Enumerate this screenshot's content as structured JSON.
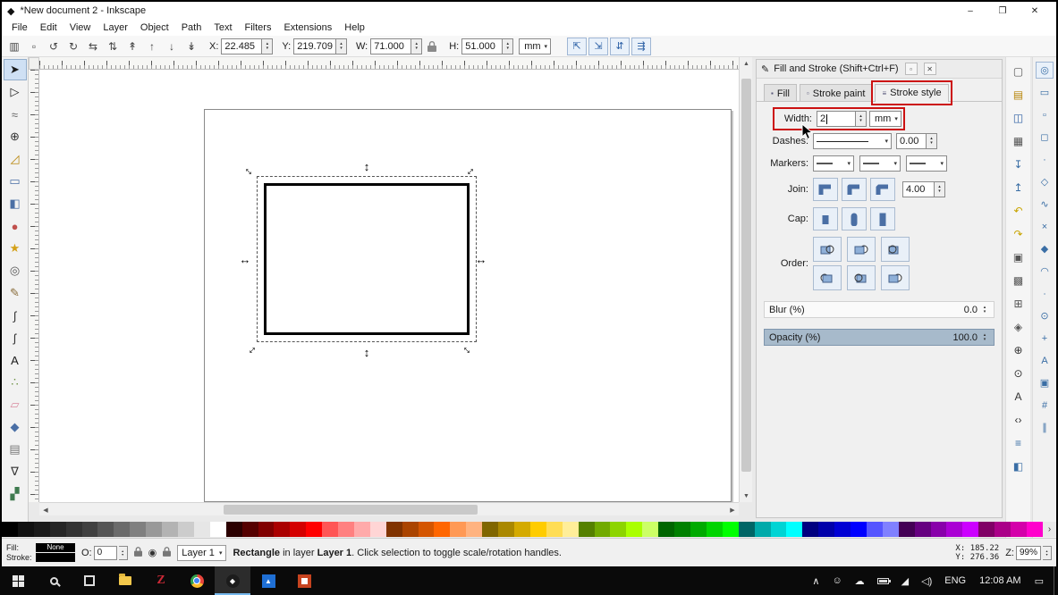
{
  "window": {
    "title": "*New document 2 - Inkscape",
    "minimize": "–",
    "maximize": "❐",
    "close": "✕"
  },
  "menubar": [
    {
      "name": "menu-file",
      "label": "File"
    },
    {
      "name": "menu-edit",
      "label": "Edit"
    },
    {
      "name": "menu-view",
      "label": "View"
    },
    {
      "name": "menu-layer",
      "label": "Layer"
    },
    {
      "name": "menu-object",
      "label": "Object"
    },
    {
      "name": "menu-path",
      "label": "Path"
    },
    {
      "name": "menu-text",
      "label": "Text"
    },
    {
      "name": "menu-filters",
      "label": "Filters"
    },
    {
      "name": "menu-extensions",
      "label": "Extensions"
    },
    {
      "name": "menu-help",
      "label": "Help"
    }
  ],
  "toolbar": {
    "icons_left": [
      {
        "name": "select-all-icon",
        "glyph": "▥"
      },
      {
        "name": "deselect-icon",
        "glyph": "▫"
      },
      {
        "name": "rotate-ccw-icon",
        "glyph": "↺"
      },
      {
        "name": "rotate-cw-icon",
        "glyph": "↻"
      },
      {
        "name": "flip-horizontal-icon",
        "glyph": "⇆"
      },
      {
        "name": "flip-vertical-icon",
        "glyph": "⇅"
      },
      {
        "name": "raise-to-top-icon",
        "glyph": "↟"
      },
      {
        "name": "raise-icon",
        "glyph": "↑"
      },
      {
        "name": "lower-icon",
        "glyph": "↓"
      },
      {
        "name": "lower-to-bottom-icon",
        "glyph": "↡"
      }
    ],
    "fields": [
      {
        "name": "x-field",
        "label": "X:",
        "value": "22.485"
      },
      {
        "name": "y-field",
        "label": "Y:",
        "value": "219.709"
      },
      {
        "name": "w-field",
        "label": "W:",
        "value": "71.000"
      }
    ],
    "h_field": {
      "label": "H:",
      "value": "51.000"
    },
    "units": "mm",
    "toggles": [
      {
        "name": "scale-stroke-toggle",
        "glyph": "⇱"
      },
      {
        "name": "scale-corners-toggle",
        "glyph": "⇲"
      },
      {
        "name": "scale-gradient-toggle",
        "glyph": "⇵"
      },
      {
        "name": "scale-pattern-toggle",
        "glyph": "⇶"
      }
    ]
  },
  "tools": [
    {
      "name": "selector-tool",
      "glyph": "➤",
      "color": "#1a1a1a"
    },
    {
      "name": "node-tool",
      "glyph": "▷",
      "color": "#1a1a1a"
    },
    {
      "name": "tweak-tool",
      "glyph": "≈",
      "color": "#666666"
    },
    {
      "name": "zoom-tool",
      "glyph": "⊕",
      "color": "#333333"
    },
    {
      "name": "measure-tool",
      "glyph": "◿",
      "color": "#b8860b"
    },
    {
      "name": "rectangle-tool",
      "glyph": "▭",
      "color": "#4a6fa5"
    },
    {
      "name": "box-3d-tool",
      "glyph": "◧",
      "color": "#4a6fa5"
    },
    {
      "name": "ellipse-tool",
      "glyph": "●",
      "color": "#c0504d"
    },
    {
      "name": "star-tool",
      "glyph": "★",
      "color": "#d4a017"
    },
    {
      "name": "spiral-tool",
      "glyph": "◎",
      "color": "#555555"
    },
    {
      "name": "pencil-tool",
      "glyph": "✎",
      "color": "#8a6d3b"
    },
    {
      "name": "bezier-tool",
      "glyph": "∫",
      "color": "#333333"
    },
    {
      "name": "calligraphy-tool",
      "glyph": "ʃ",
      "color": "#333333"
    },
    {
      "name": "text-tool",
      "glyph": "A",
      "color": "#1a1a1a"
    },
    {
      "name": "spray-tool",
      "glyph": "∴",
      "color": "#6a8f3f"
    },
    {
      "name": "eraser-tool",
      "glyph": "▱",
      "color": "#d98ca0"
    },
    {
      "name": "bucket-tool",
      "glyph": "◆",
      "color": "#4a6fa5"
    },
    {
      "name": "gradient-tool",
      "glyph": "▤",
      "color": "#777777"
    },
    {
      "name": "dropper-tool",
      "glyph": "∇",
      "color": "#333333"
    },
    {
      "name": "connector-tool",
      "glyph": "▞",
      "color": "#3f7a4f"
    }
  ],
  "commands": [
    {
      "name": "new-document-icon",
      "glyph": "▢",
      "color": "#555555"
    },
    {
      "name": "open-document-icon",
      "glyph": "▤",
      "color": "#b8860b"
    },
    {
      "name": "save-icon",
      "glyph": "◫",
      "color": "#2e5fa3"
    },
    {
      "name": "print-icon",
      "glyph": "▦",
      "color": "#555555"
    },
    {
      "name": "import-icon",
      "glyph": "↧",
      "color": "#3a6ea5"
    },
    {
      "name": "export-icon",
      "glyph": "↥",
      "color": "#3a6ea5"
    },
    {
      "name": "undo-icon",
      "glyph": "↶",
      "color": "#c8a400"
    },
    {
      "name": "redo-icon",
      "glyph": "↷",
      "color": "#c8a400"
    },
    {
      "name": "copy-icon",
      "glyph": "▣",
      "color": "#555555"
    },
    {
      "name": "paste-icon",
      "glyph": "▩",
      "color": "#555555"
    },
    {
      "name": "duplicate-icon",
      "glyph": "⊞",
      "color": "#555555"
    },
    {
      "name": "clone-icon",
      "glyph": "◈",
      "color": "#555555"
    },
    {
      "name": "zoom-drawing-icon",
      "glyph": "⊕",
      "color": "#333333"
    },
    {
      "name": "zoom-page-icon",
      "glyph": "⊙",
      "color": "#333333"
    },
    {
      "name": "text-and-font-icon",
      "glyph": "A",
      "color": "#333333"
    },
    {
      "name": "xml-editor-icon",
      "glyph": "‹›",
      "color": "#333333"
    },
    {
      "name": "align-distribute-icon",
      "glyph": "≡",
      "color": "#3a6ea5"
    },
    {
      "name": "fill-stroke-dialog-icon",
      "glyph": "◧",
      "color": "#3a6ea5"
    }
  ],
  "snaps": [
    {
      "name": "snap-toggle-icon",
      "glyph": "◎"
    },
    {
      "name": "snap-bbox-icon",
      "glyph": "▭"
    },
    {
      "name": "snap-bbox-edges-icon",
      "glyph": "▫"
    },
    {
      "name": "snap-bbox-corners-icon",
      "glyph": "◻"
    },
    {
      "name": "snap-bbox-midpoints-icon",
      "glyph": "·"
    },
    {
      "name": "snap-nodes-icon",
      "glyph": "◇"
    },
    {
      "name": "snap-paths-icon",
      "glyph": "∿"
    },
    {
      "name": "snap-intersections-icon",
      "glyph": "×"
    },
    {
      "name": "snap-cusp-nodes-icon",
      "glyph": "◆"
    },
    {
      "name": "snap-smooth-nodes-icon",
      "glyph": "◠"
    },
    {
      "name": "snap-midpoints-icon",
      "glyph": "∙"
    },
    {
      "name": "snap-object-centers-icon",
      "glyph": "⊙"
    },
    {
      "name": "snap-rotation-center-icon",
      "glyph": "+"
    },
    {
      "name": "snap-text-baseline-icon",
      "glyph": "A"
    },
    {
      "name": "snap-page-border-icon",
      "glyph": "▣"
    },
    {
      "name": "snap-grid-icon",
      "glyph": "#"
    },
    {
      "name": "snap-guides-icon",
      "glyph": "∥"
    }
  ],
  "dock": {
    "title": "Fill and Stroke (Shift+Ctrl+F)",
    "tabs": [
      {
        "name": "tab-fill",
        "label": "Fill",
        "icon": "▪"
      },
      {
        "name": "tab-stroke-paint",
        "label": "Stroke paint",
        "icon": "▫"
      },
      {
        "name": "tab-stroke-style",
        "label": "Stroke style",
        "icon": "≡"
      }
    ],
    "width": {
      "label": "Width:",
      "value": "2",
      "unit": "mm"
    },
    "dashes": {
      "label": "Dashes:",
      "value": "0.00"
    },
    "markers": {
      "label": "Markers:"
    },
    "join": {
      "label": "Join:",
      "miter_value": "4.00"
    },
    "cap": {
      "label": "Cap:"
    },
    "order": {
      "label": "Order:"
    },
    "blur": {
      "label": "Blur (%)",
      "value": "0.0",
      "percent": 0
    },
    "opacity": {
      "label": "Opacity (%)",
      "value": "100.0",
      "percent": 100
    }
  },
  "annotation_color": "#cc1111",
  "palette": [
    "#000000",
    "#111111",
    "#1a1a1a",
    "#262626",
    "#333333",
    "#404040",
    "#555555",
    "#6b6b6b",
    "#808080",
    "#999999",
    "#b3b3b3",
    "#cccccc",
    "#e6e6e6",
    "#ffffff",
    "#2b0000",
    "#550000",
    "#800000",
    "#aa0000",
    "#d40000",
    "#ff0000",
    "#ff5555",
    "#ff8080",
    "#ffaaaa",
    "#ffd5d5",
    "#803300",
    "#aa4400",
    "#d45500",
    "#ff6600",
    "#ff9955",
    "#ffb380",
    "#806600",
    "#aa8800",
    "#d4aa00",
    "#ffcc00",
    "#ffdd55",
    "#ffee99",
    "#558000",
    "#71aa00",
    "#8dd400",
    "#aaff00",
    "#ccff66",
    "#006600",
    "#008000",
    "#00aa00",
    "#00d400",
    "#00ff00",
    "#006666",
    "#00aaaa",
    "#00d4d4",
    "#00ffff",
    "#000080",
    "#0000aa",
    "#0000d4",
    "#0000ff",
    "#5555ff",
    "#8080ff",
    "#440055",
    "#660080",
    "#8800aa",
    "#aa00d4",
    "#cc00ff",
    "#800066",
    "#aa0088",
    "#d400aa",
    "#ff00cc"
  ],
  "statusbar": {
    "fill_label": "Fill:",
    "fill_value": "None",
    "stroke_label": "Stroke:",
    "o_label": "O:",
    "o_value": "0",
    "layer": "Layer 1",
    "msg_bold1": "Rectangle",
    "msg_text1": " in layer ",
    "msg_bold2": "Layer 1",
    "msg_text2": ". Click selection to toggle scale/rotation handles.",
    "x_label": "X:",
    "x_value": "185.22",
    "y_label": "Y:",
    "y_value": "276.36",
    "z_label": "Z:",
    "zoom": "99%"
  },
  "taskbar": {
    "zotero_letter": "Z",
    "language": "ENG",
    "time": "12:08 AM"
  }
}
